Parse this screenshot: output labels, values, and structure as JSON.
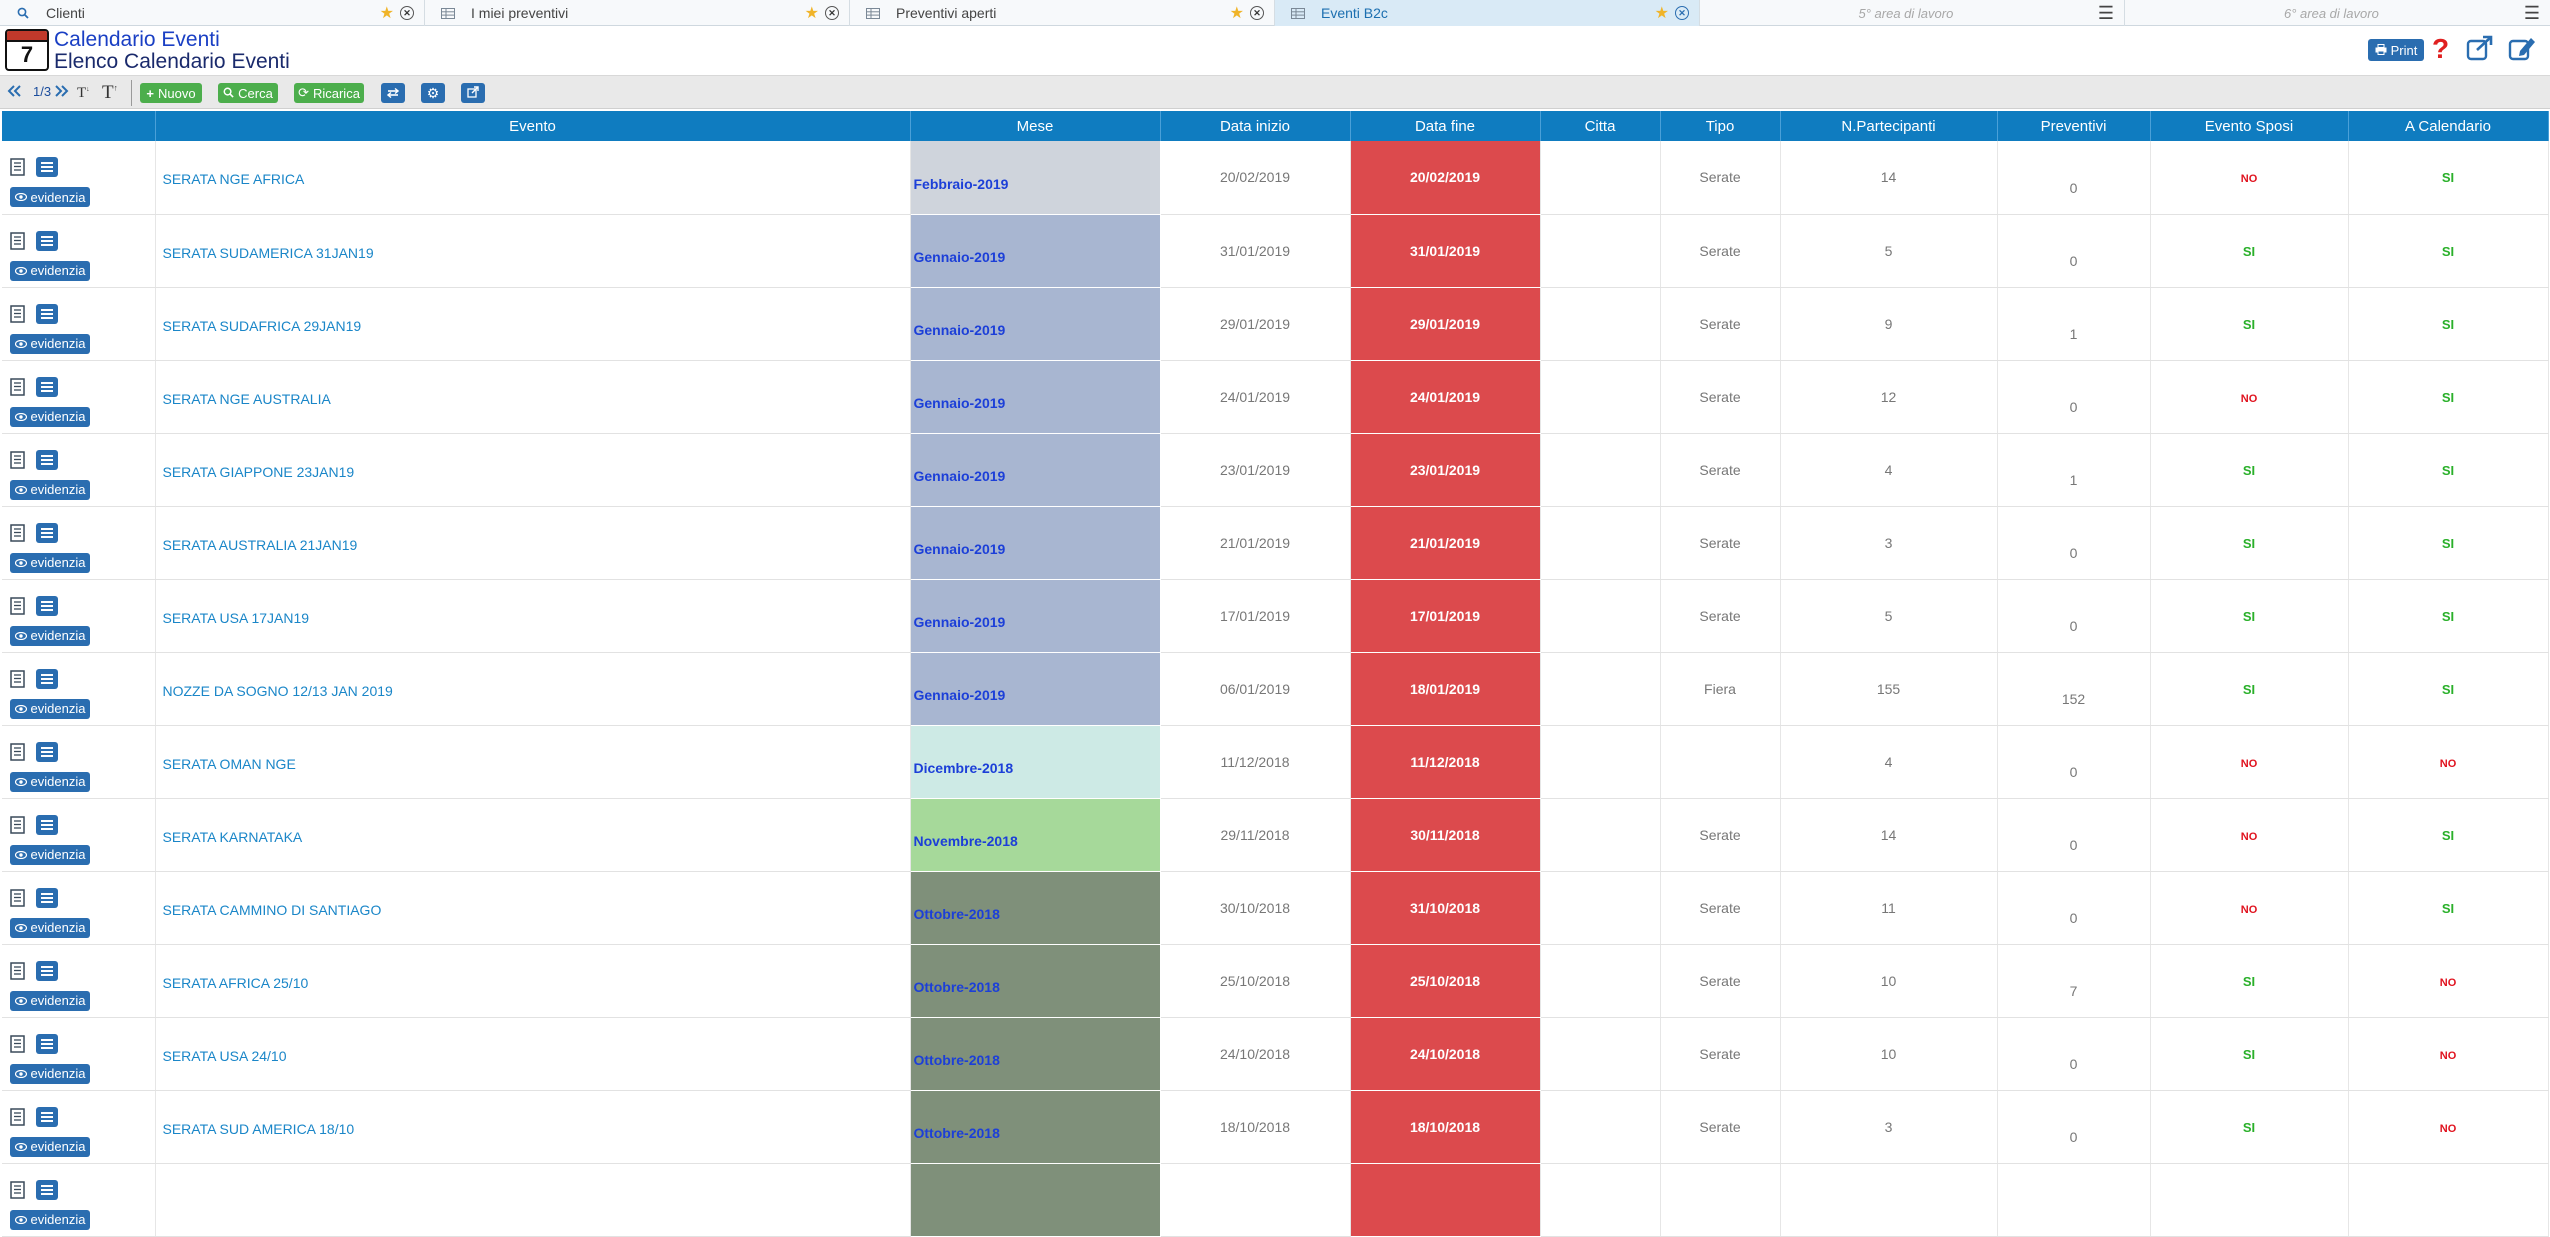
{
  "tabs": [
    {
      "label": "Clienti",
      "icon": "search-icon",
      "active": false,
      "empty": false
    },
    {
      "label": "I miei preventivi",
      "icon": "table-icon",
      "active": false,
      "empty": false
    },
    {
      "label": "Preventivi aperti",
      "icon": "table-icon",
      "active": false,
      "empty": false
    },
    {
      "label": "Eventi B2c",
      "icon": "table-icon",
      "active": true,
      "empty": false
    },
    {
      "label": "5° area di lavoro",
      "icon": "",
      "active": false,
      "empty": true
    },
    {
      "label": "6° area di lavoro",
      "icon": "",
      "active": false,
      "empty": true
    }
  ],
  "app": {
    "icon_number": "7",
    "title": "Calendario Eventi",
    "subtitle": "Elenco Calendario Eventi",
    "print_label": "Print"
  },
  "toolbar": {
    "page_indicator": "1/3",
    "font_small": "T",
    "font_large": "T",
    "new_label": "Nuovo",
    "search_label": "Cerca",
    "reload_label": "Ricarica"
  },
  "colors": {
    "header": "#0f7cc0",
    "date_end": "#dc4a4d",
    "si": "#2ab02a",
    "no": "#e0121e",
    "button_blue": "#2a6db0",
    "button_green": "#4cae4c"
  },
  "table": {
    "evidenzia_label": "evidenzia",
    "columns": [
      "",
      "Evento",
      "Mese",
      "Data inizio",
      "Data fine",
      "Citta",
      "Tipo",
      "N.Partecipanti",
      "Preventivi",
      "Evento Sposi",
      "A Calendario"
    ],
    "rows": [
      {
        "evento": "SERATA NGE AFRICA",
        "mese": "Febbraio-2019",
        "mese_color": "#cfd4dc",
        "inizio": "20/02/2019",
        "fine": "20/02/2019",
        "citta": "",
        "tipo": "Serate",
        "partecipanti": "14",
        "preventivi": "0",
        "sposi": "NO",
        "calendario": "SI"
      },
      {
        "evento": "SERATA SUDAMERICA 31JAN19",
        "mese": "Gennaio-2019",
        "mese_color": "#a8b6d1",
        "inizio": "31/01/2019",
        "fine": "31/01/2019",
        "citta": "",
        "tipo": "Serate",
        "partecipanti": "5",
        "preventivi": "0",
        "sposi": "SI",
        "calendario": "SI"
      },
      {
        "evento": "SERATA SUDAFRICA 29JAN19",
        "mese": "Gennaio-2019",
        "mese_color": "#a8b6d1",
        "inizio": "29/01/2019",
        "fine": "29/01/2019",
        "citta": "",
        "tipo": "Serate",
        "partecipanti": "9",
        "preventivi": "1",
        "sposi": "SI",
        "calendario": "SI"
      },
      {
        "evento": "SERATA NGE AUSTRALIA",
        "mese": "Gennaio-2019",
        "mese_color": "#a8b6d1",
        "inizio": "24/01/2019",
        "fine": "24/01/2019",
        "citta": "",
        "tipo": "Serate",
        "partecipanti": "12",
        "preventivi": "0",
        "sposi": "NO",
        "calendario": "SI"
      },
      {
        "evento": "SERATA GIAPPONE 23JAN19",
        "mese": "Gennaio-2019",
        "mese_color": "#a8b6d1",
        "inizio": "23/01/2019",
        "fine": "23/01/2019",
        "citta": "",
        "tipo": "Serate",
        "partecipanti": "4",
        "preventivi": "1",
        "sposi": "SI",
        "calendario": "SI"
      },
      {
        "evento": "SERATA AUSTRALIA 21JAN19",
        "mese": "Gennaio-2019",
        "mese_color": "#a8b6d1",
        "inizio": "21/01/2019",
        "fine": "21/01/2019",
        "citta": "",
        "tipo": "Serate",
        "partecipanti": "3",
        "preventivi": "0",
        "sposi": "SI",
        "calendario": "SI"
      },
      {
        "evento": "SERATA USA 17JAN19",
        "mese": "Gennaio-2019",
        "mese_color": "#a8b6d1",
        "inizio": "17/01/2019",
        "fine": "17/01/2019",
        "citta": "",
        "tipo": "Serate",
        "partecipanti": "5",
        "preventivi": "0",
        "sposi": "SI",
        "calendario": "SI"
      },
      {
        "evento": "NOZZE DA SOGNO 12/13 JAN 2019",
        "mese": "Gennaio-2019",
        "mese_color": "#a8b6d1",
        "inizio": "06/01/2019",
        "fine": "18/01/2019",
        "citta": "",
        "tipo": "Fiera",
        "partecipanti": "155",
        "preventivi": "152",
        "sposi": "SI",
        "calendario": "SI"
      },
      {
        "evento": "SERATA OMAN NGE",
        "mese": "Dicembre-2018",
        "mese_color": "#cdeae5",
        "inizio": "11/12/2018",
        "fine": "11/12/2018",
        "citta": "",
        "tipo": "",
        "partecipanti": "4",
        "preventivi": "0",
        "sposi": "NO",
        "calendario": "NO"
      },
      {
        "evento": "SERATA KARNATAKA",
        "mese": "Novembre-2018",
        "mese_color": "#a6d99a",
        "inizio": "29/11/2018",
        "fine": "30/11/2018",
        "citta": "",
        "tipo": "Serate",
        "partecipanti": "14",
        "preventivi": "0",
        "sposi": "NO",
        "calendario": "SI"
      },
      {
        "evento": "SERATA CAMMINO DI SANTIAGO",
        "mese": "Ottobre-2018",
        "mese_color": "#7f907a",
        "inizio": "30/10/2018",
        "fine": "31/10/2018",
        "citta": "",
        "tipo": "Serate",
        "partecipanti": "11",
        "preventivi": "0",
        "sposi": "NO",
        "calendario": "SI"
      },
      {
        "evento": "SERATA AFRICA 25/10",
        "mese": "Ottobre-2018",
        "mese_color": "#7f907a",
        "inizio": "25/10/2018",
        "fine": "25/10/2018",
        "citta": "",
        "tipo": "Serate",
        "partecipanti": "10",
        "preventivi": "7",
        "sposi": "SI",
        "calendario": "NO"
      },
      {
        "evento": "SERATA USA 24/10",
        "mese": "Ottobre-2018",
        "mese_color": "#7f907a",
        "inizio": "24/10/2018",
        "fine": "24/10/2018",
        "citta": "",
        "tipo": "Serate",
        "partecipanti": "10",
        "preventivi": "0",
        "sposi": "SI",
        "calendario": "NO"
      },
      {
        "evento": "SERATA SUD AMERICA 18/10",
        "mese": "Ottobre-2018",
        "mese_color": "#7f907a",
        "inizio": "18/10/2018",
        "fine": "18/10/2018",
        "citta": "",
        "tipo": "Serate",
        "partecipanti": "3",
        "preventivi": "0",
        "sposi": "SI",
        "calendario": "NO"
      },
      {
        "evento": "",
        "mese": "",
        "mese_color": "#7f907a",
        "inizio": "",
        "fine": "",
        "citta": "",
        "tipo": "",
        "partecipanti": "",
        "preventivi": "",
        "sposi": "",
        "calendario": ""
      }
    ]
  }
}
